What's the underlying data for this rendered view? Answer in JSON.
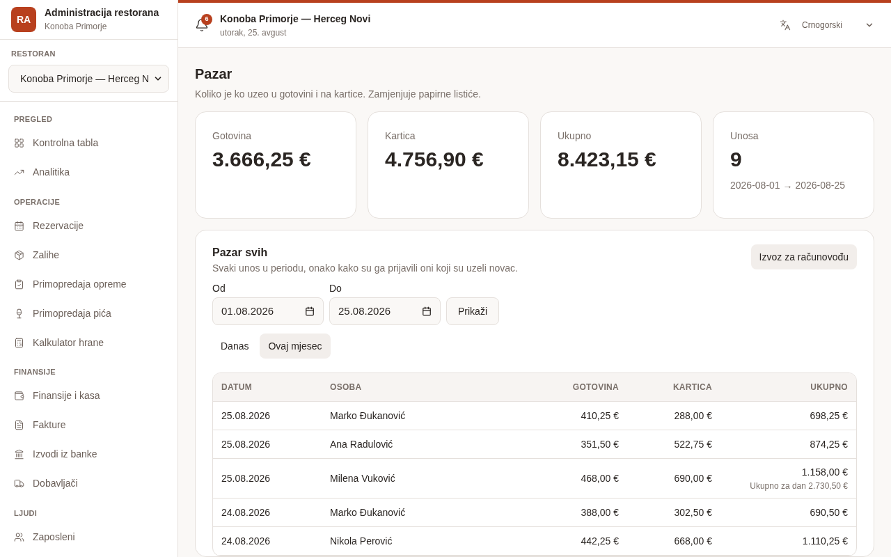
{
  "app": {
    "logo": "RA",
    "title": "Administracija restorana",
    "subtitle": "Konoba Primorje"
  },
  "restaurant_select": {
    "label": "RESTORAN",
    "value": "Konoba Primorje — Herceg N"
  },
  "nav_sections": [
    {
      "title": "PREGLED",
      "items": [
        {
          "label": "Kontrolna tabla"
        },
        {
          "label": "Analitika"
        }
      ]
    },
    {
      "title": "OPERACIJE",
      "items": [
        {
          "label": "Rezervacije"
        },
        {
          "label": "Zalihe"
        },
        {
          "label": "Primopredaja opreme"
        },
        {
          "label": "Primopredaja pića"
        },
        {
          "label": "Kalkulator hrane"
        }
      ]
    },
    {
      "title": "FINANSIJE",
      "items": [
        {
          "label": "Finansije i kasa"
        },
        {
          "label": "Fakture"
        },
        {
          "label": "Izvodi iz banke"
        },
        {
          "label": "Dobavljači"
        }
      ]
    },
    {
      "title": "LJUDI",
      "items": [
        {
          "label": "Zaposleni"
        }
      ]
    }
  ],
  "header": {
    "notifications": "6",
    "title": "Konoba Primorje — Herceg Novi",
    "date": "utorak, 25. avgust",
    "language": "Crnogorski"
  },
  "page": {
    "title": "Pazar",
    "subtitle": "Koliko je ko uzeo u gotovini i na kartice. Zamjenjuje papirne listiće."
  },
  "stats": [
    {
      "label": "Gotovina",
      "value": "3.666,25 €"
    },
    {
      "label": "Kartica",
      "value": "4.756,90 €"
    },
    {
      "label": "Ukupno",
      "value": "8.423,15 €"
    },
    {
      "label": "Unosa",
      "value": "9",
      "note": "2026-08-01 → 2026-08-25"
    }
  ],
  "panel": {
    "title": "Pazar svih",
    "subtitle": "Svaki unos u periodu, onako kako su ga prijavili oni koji su uzeli novac.",
    "export_button": "Izvoz za računovođu",
    "from": {
      "label": "Od",
      "value": "01.08.2026"
    },
    "to": {
      "label": "Do",
      "value": "25.08.2026"
    },
    "show_button": "Prikaži",
    "quick_filters": [
      {
        "label": "Danas",
        "selected": false
      },
      {
        "label": "Ovaj mjesec",
        "selected": true
      }
    ]
  },
  "table": {
    "columns": [
      "DATUM",
      "OSOBA",
      "GOTOVINA",
      "KARTICA",
      "UKUPNO"
    ],
    "rows": [
      {
        "date": "25.08.2026",
        "person": "Marko Đukanović",
        "cash": "410,25 €",
        "card": "288,00 €",
        "total": "698,25 €"
      },
      {
        "date": "25.08.2026",
        "person": "Ana Radulović",
        "cash": "351,50 €",
        "card": "522,75 €",
        "total": "874,25 €"
      },
      {
        "date": "25.08.2026",
        "person": "Milena Vuković",
        "cash": "468,00 €",
        "card": "690,00 €",
        "total": "1.158,00 €",
        "day_total": "Ukupno za dan 2.730,50 €"
      },
      {
        "date": "24.08.2026",
        "person": "Marko Đukanović",
        "cash": "388,00 €",
        "card": "302,50 €",
        "total": "690,50 €"
      },
      {
        "date": "24.08.2026",
        "person": "Nikola Perović",
        "cash": "442,25 €",
        "card": "668,00 €",
        "total": "1.110,25 €"
      }
    ]
  }
}
